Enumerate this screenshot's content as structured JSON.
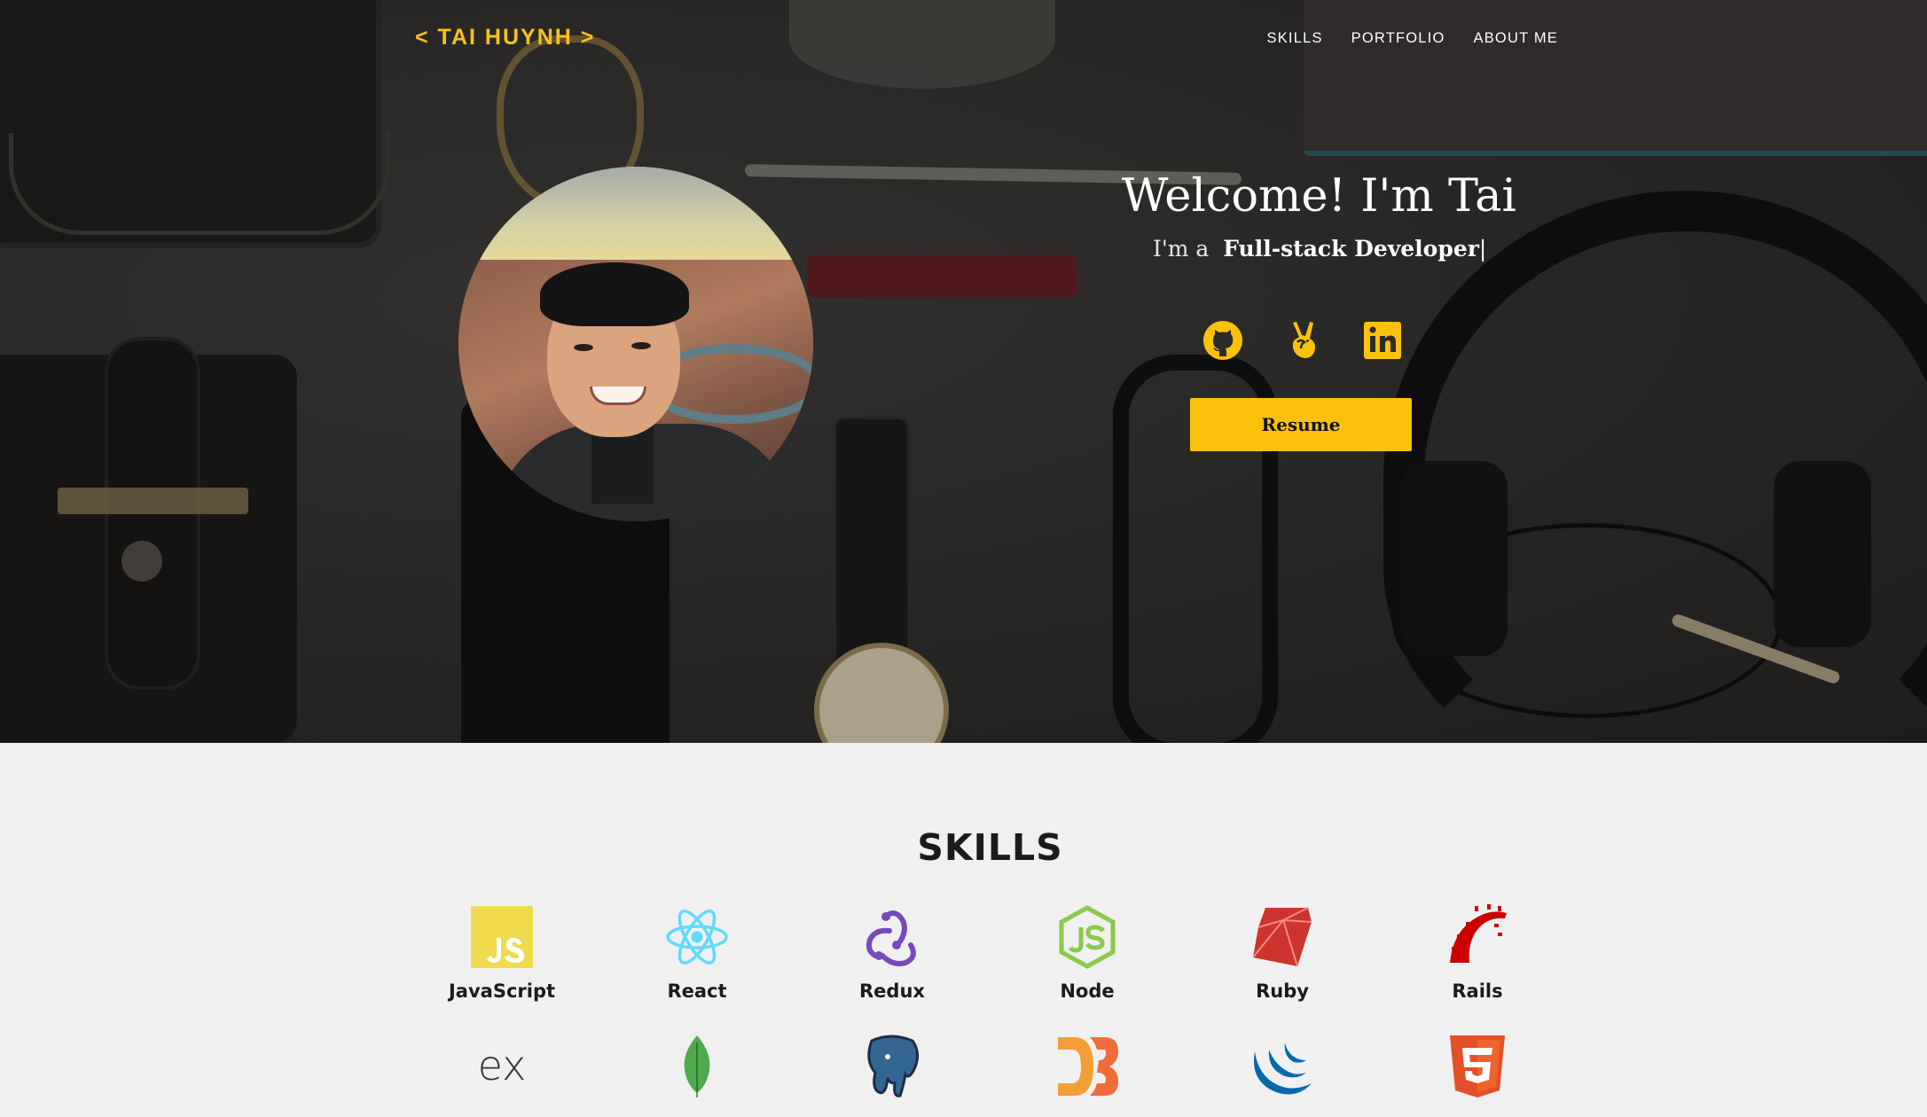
{
  "header": {
    "brand": "< TAI HUYNH >",
    "nav": [
      "SKILLS",
      "PORTFOLIO",
      "ABOUT ME"
    ]
  },
  "hero": {
    "title": "Welcome! I'm Tai",
    "tagline_prefix": "I'm a",
    "tagline_role": "Full-stack Developer",
    "tagline_cursor": "|",
    "socials": [
      "github-icon",
      "angellist-icon",
      "linkedin-icon"
    ],
    "resume_label": "Resume"
  },
  "skills": {
    "title": "SKILLS",
    "row1": [
      {
        "label": "JavaScript",
        "icon": "javascript-icon"
      },
      {
        "label": "React",
        "icon": "react-icon"
      },
      {
        "label": "Redux",
        "icon": "redux-icon"
      },
      {
        "label": "Node",
        "icon": "node-icon"
      },
      {
        "label": "Ruby",
        "icon": "ruby-icon"
      },
      {
        "label": "Rails",
        "icon": "rails-icon"
      }
    ],
    "row2_icons": [
      "express-icon",
      "mongodb-icon",
      "postgresql-icon",
      "d3-icon",
      "jquery-icon",
      "html5-icon"
    ]
  },
  "colors": {
    "accent": "#fcc20b",
    "brand": "#f7c21a",
    "hero_overlay": "#2d2b29",
    "page_bg": "#f0f0f0"
  }
}
